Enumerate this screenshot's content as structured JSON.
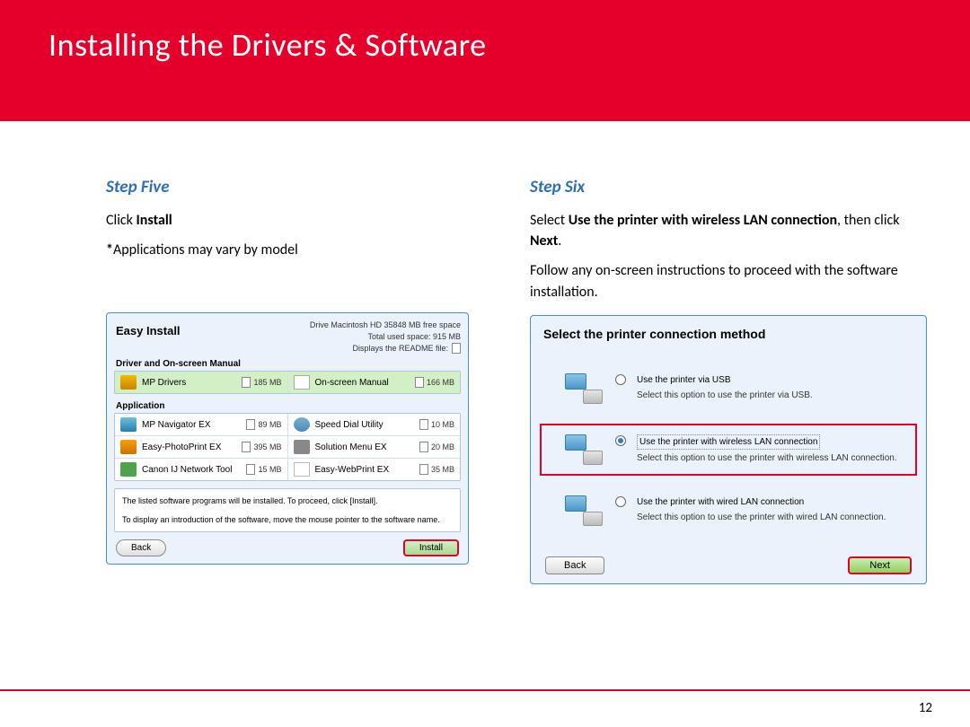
{
  "page": {
    "title": "Installing  the Drivers & Software",
    "number": "12"
  },
  "step5": {
    "heading": "Step Five",
    "line1a": "Click ",
    "line1b": "Install",
    "line2a": "*",
    "line2b": "Applications may vary by model"
  },
  "step6": {
    "heading": "Step Six",
    "l1a": "Select ",
    "l1b": "Use the printer with wireless LAN connection",
    "l1c": ", then click ",
    "l1d": "Next",
    "l1e": ".",
    "l2": "Follow any on-screen instructions to proceed with the software installation."
  },
  "dlg1": {
    "title": "Easy Install",
    "meta1": "Drive Macintosh HD 35848 MB free space",
    "meta2": "Total used space: 915 MB",
    "meta3": "Displays the README file:",
    "sect1": "Driver and On-screen Manual",
    "r1a": "MP Drivers",
    "r1am": "185 MB",
    "r1b": "On-screen Manual",
    "r1bm": "166 MB",
    "sect2": "Application",
    "r2a": "MP Navigator EX",
    "r2am": "89 MB",
    "r2b": "Speed Dial Utility",
    "r2bm": "10 MB",
    "r2c": "Easy-PhotoPrint EX",
    "r2cm": "395 MB",
    "r2d": "Solution Menu EX",
    "r2dm": "20 MB",
    "r2e": "Canon IJ Network Tool",
    "r2em": "15 MB",
    "r2f": "Easy-WebPrint EX",
    "r2fm": "35 MB",
    "note1": "The listed software programs will be installed. To proceed, click [Install].",
    "note2": "To display an introduction of the software, move the mouse pointer to the software name.",
    "back": "Back",
    "install": "Install"
  },
  "dlg2": {
    "title": "Select the printer connection method",
    "o1t": "Use the printer via USB",
    "o1s": "Select this option to use the printer via USB.",
    "o2t": "Use the printer with wireless LAN connection",
    "o2s": "Select this option to use the printer with wireless LAN connection.",
    "o3t": "Use the printer with wired LAN connection",
    "o3s": "Select this option to use the printer with wired LAN connection.",
    "back": "Back",
    "next": "Next"
  }
}
